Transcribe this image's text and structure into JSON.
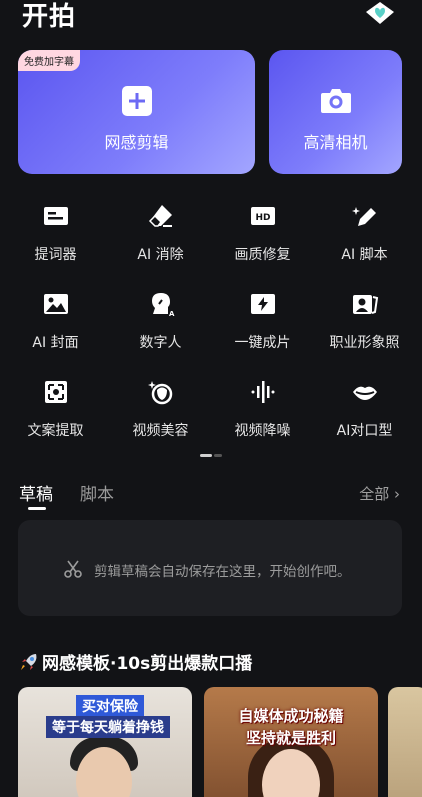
{
  "header": {
    "title": "开拍",
    "vip_icon": "diamond-heart-icon"
  },
  "big_cards": [
    {
      "label": "网感剪辑",
      "icon": "plus-square-icon",
      "badge": "免费加字幕"
    },
    {
      "label": "高清相机",
      "icon": "camera-icon"
    }
  ],
  "tools": [
    {
      "label": "提词器",
      "icon": "teleprompter-icon"
    },
    {
      "label": "AI 消除",
      "icon": "eraser-icon"
    },
    {
      "label": "画质修复",
      "icon": "hd-icon"
    },
    {
      "label": "AI 脚本",
      "icon": "pen-sparkle-icon"
    },
    {
      "label": "AI 封面",
      "icon": "image-icon"
    },
    {
      "label": "数字人",
      "icon": "digital-human-icon"
    },
    {
      "label": "一键成片",
      "icon": "lightning-icon"
    },
    {
      "label": "职业形象照",
      "icon": "portrait-card-icon"
    },
    {
      "label": "文案提取",
      "icon": "text-extract-icon"
    },
    {
      "label": "视频美容",
      "icon": "face-beauty-icon"
    },
    {
      "label": "视频降噪",
      "icon": "noise-reduction-icon"
    },
    {
      "label": "AI对口型",
      "icon": "lips-icon"
    }
  ],
  "tabs": {
    "active": "草稿",
    "inactive": "脚本",
    "all": "全部 ›"
  },
  "drafts": {
    "empty_text": "剪辑草稿会自动保存在这里，开始创作吧。",
    "icon": "scissors-icon"
  },
  "templates": {
    "title": "网感模板·10s剪出爆款口播",
    "icon": "rocket-icon",
    "items": [
      {
        "caption_top": "买对保险",
        "caption_bottom": "等于每天躺着挣钱"
      },
      {
        "caption_top": "自媒体成功秘籍",
        "caption_bottom": "坚持就是胜利"
      }
    ]
  }
}
